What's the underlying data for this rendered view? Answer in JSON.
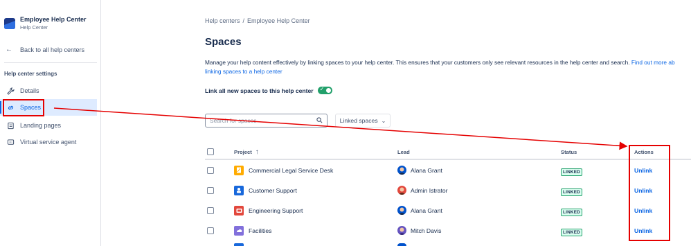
{
  "sidebar": {
    "brand": {
      "title": "Employee Help Center",
      "subtitle": "Help Center"
    },
    "back_link": "Back to all help centers",
    "section_title": "Help center settings",
    "items": [
      {
        "label": "Details",
        "icon": "wrench-icon"
      },
      {
        "label": "Spaces",
        "icon": "link-icon",
        "active": true
      },
      {
        "label": "Landing pages",
        "icon": "page-icon"
      },
      {
        "label": "Virtual service agent",
        "icon": "chat-icon"
      }
    ]
  },
  "breadcrumb": {
    "first": "Help centers",
    "separator": "/",
    "second": "Employee Help Center"
  },
  "page": {
    "title": "Spaces",
    "description": "Manage your help content effectively by linking spaces to your help center. This ensures that your customers only see relevant resources in the help center and search.",
    "description_link_part1": "Find out more ab",
    "description_link_part2": "linking spaces to a help center",
    "link_all_label": "Link all new spaces to this help center",
    "link_all_enabled": true
  },
  "filters": {
    "search_placeholder": "Search for spaces",
    "dropdown_label": "Linked spaces"
  },
  "table": {
    "headers": {
      "project": "Project",
      "lead": "Lead",
      "status": "Status",
      "actions": "Actions"
    },
    "rows": [
      {
        "project": "Commercial Legal Service Desk",
        "project_color": "#ffab00",
        "lead": "Alana Grant",
        "avatar_color": "#0052cc",
        "status": "LINKED",
        "action": "Unlink"
      },
      {
        "project": "Customer Support",
        "project_color": "#1868db",
        "lead": "Admin Istrator",
        "avatar_color": "#e2483d",
        "status": "LINKED",
        "action": "Unlink"
      },
      {
        "project": "Engineering Support",
        "project_color": "#e2483d",
        "lead": "Alana Grant",
        "avatar_color": "#0052cc",
        "status": "LINKED",
        "action": "Unlink"
      },
      {
        "project": "Facilities",
        "project_color": "#8270db",
        "lead": "Mitch Davis",
        "avatar_color": "#6554c0",
        "status": "LINKED",
        "action": "Unlink"
      }
    ]
  },
  "colors": {
    "accent": "#0c66e4",
    "annotation": "#e50000",
    "toggle_on": "#22a06b"
  }
}
